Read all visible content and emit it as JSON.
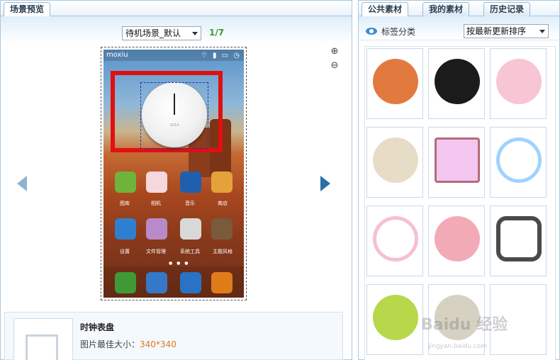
{
  "left_panel": {
    "tab_label": "场景预览",
    "scene_select": "待机场景_默认",
    "page_indicator": "1/7",
    "phone": {
      "brand": "moxiu",
      "apps_row1": [
        "图库",
        "相机",
        "音乐",
        "商店"
      ],
      "apps_row2": [
        "设置",
        "文件管理",
        "系统工具",
        "主题风格"
      ]
    },
    "detail": {
      "title": "时钟表盘",
      "size_label": "图片最佳大小：",
      "size_value": "340*340"
    }
  },
  "right_panel": {
    "tabs": [
      "公共素材",
      "我的素材",
      "历史记录"
    ],
    "tag_label": "标签分类",
    "sort_select": "按最新更新排序",
    "watermark": "Baidu 经验",
    "watermark_sub": "jingyan.baidu.com",
    "clock_faces": [
      {
        "name": "orange-clock",
        "color": "#e27a3f"
      },
      {
        "name": "black-clock",
        "color": "#1b1b1b"
      },
      {
        "name": "music-clock",
        "color": "#f7c5d4"
      },
      {
        "name": "beige-clock",
        "color": "#e7ddc7"
      },
      {
        "name": "pink-square-clock",
        "color": "#f3c6f0"
      },
      {
        "name": "blue-ring-clock",
        "color": "#9fd2ff"
      },
      {
        "name": "heart-ring-clock",
        "color": "#f6c0d3"
      },
      {
        "name": "dragonfly-clock",
        "color": "#f3aab7"
      },
      {
        "name": "dark-frame-clock",
        "color": "#4a4a4a"
      },
      {
        "name": "green-clock",
        "color": "#b6d84a"
      },
      {
        "name": "vintage-clock",
        "color": "#d6d1c1"
      },
      {
        "name": "empty-slot",
        "color": "#ffffff"
      }
    ]
  }
}
